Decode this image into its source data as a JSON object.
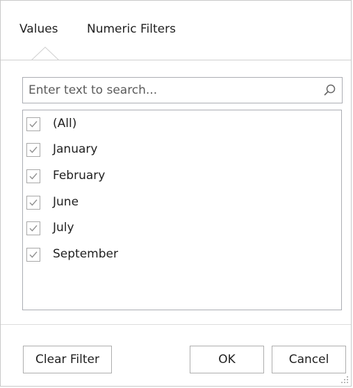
{
  "tabs": [
    {
      "label": "Values",
      "selected": true
    },
    {
      "label": "Numeric Filters",
      "selected": false
    }
  ],
  "search": {
    "value": "",
    "placeholder": "Enter text to search...",
    "icon": "search-icon"
  },
  "list": {
    "items": [
      {
        "label": "(All)",
        "checked": true
      },
      {
        "label": "January",
        "checked": true
      },
      {
        "label": "February",
        "checked": true
      },
      {
        "label": "June",
        "checked": true
      },
      {
        "label": "July",
        "checked": true
      },
      {
        "label": "September",
        "checked": true
      }
    ]
  },
  "buttons": {
    "clear_filter": "Clear Filter",
    "ok": "OK",
    "cancel": "Cancel"
  },
  "colors": {
    "border": "#abadb3",
    "check": "#8e8e8e",
    "text": "#1f1f1f"
  }
}
